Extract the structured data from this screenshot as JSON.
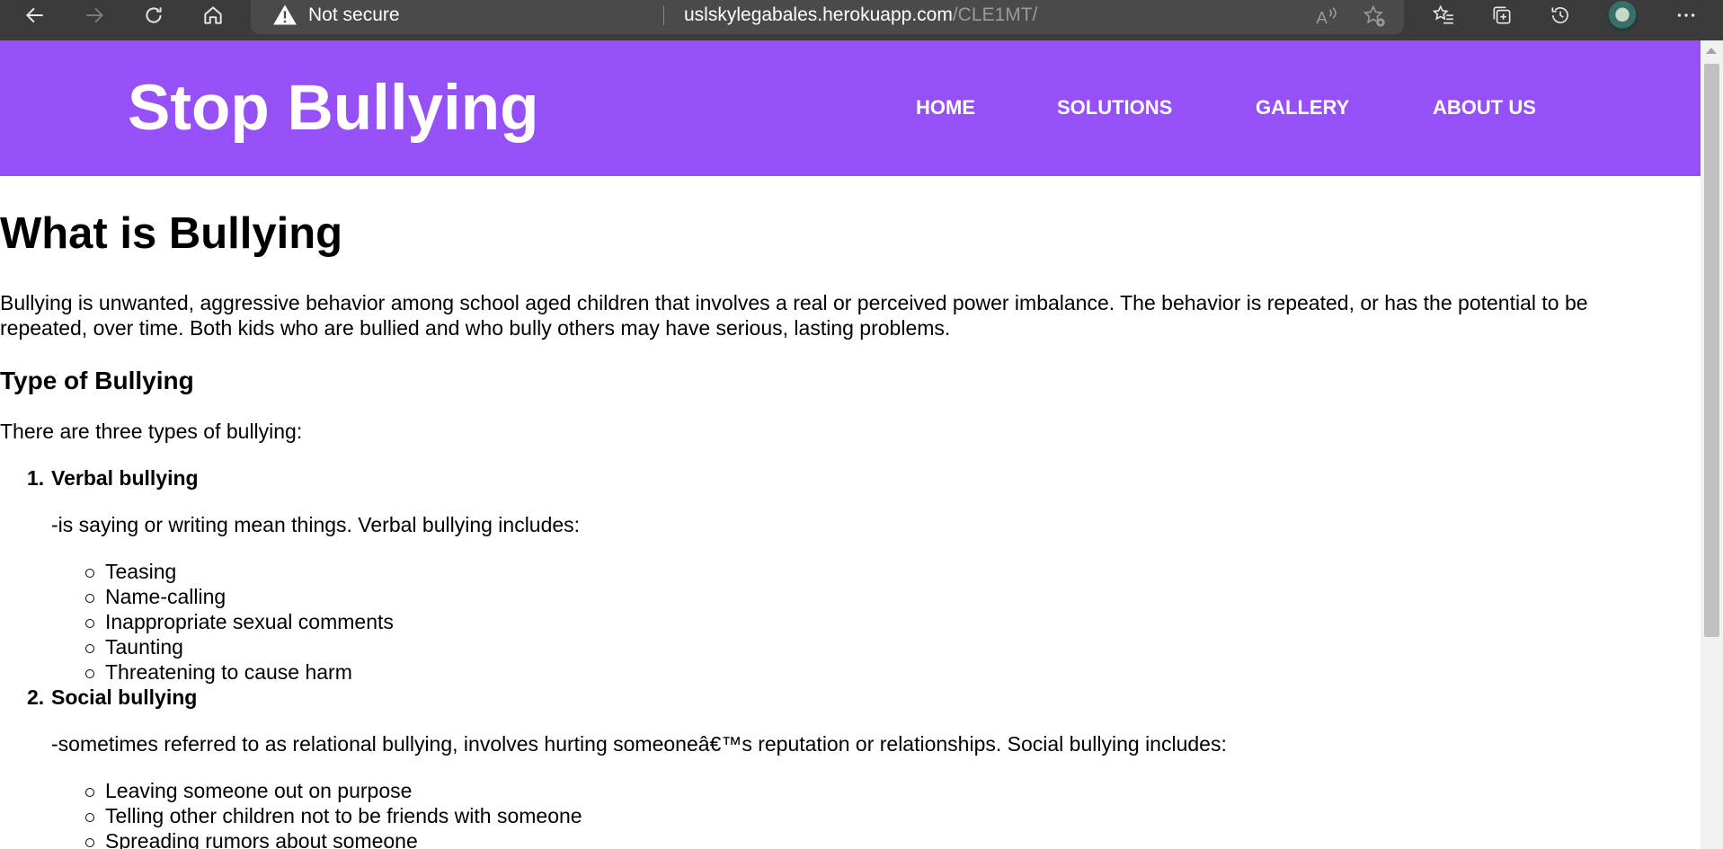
{
  "browser": {
    "security_label": "Not secure",
    "url_host": "uslskylegabales.herokuapp.com",
    "url_path": "/CLE1MT/"
  },
  "site": {
    "brand": "Stop Bullying",
    "nav": [
      "HOME",
      "SOLUTIONS",
      "GALLERY",
      "ABOUT US"
    ]
  },
  "content": {
    "title": "What is Bullying",
    "intro_line1": "Bullying is unwanted, aggressive behavior among school aged children that involves a real or perceived power imbalance. The behavior is repeated, or has the potential to be",
    "intro_line2": "repeated, over time. Both kids who are bullied and who bully others may have serious, lasting problems.",
    "types_heading": "Type of Bullying",
    "types_intro": "There are three types of bullying:",
    "types": [
      {
        "number": "1.",
        "name": "Verbal bullying",
        "description": "-is saying or writing mean things. Verbal bullying includes:",
        "items": [
          "Teasing",
          "Name-calling",
          "Inappropriate sexual comments",
          "Taunting",
          "Threatening to cause harm"
        ]
      },
      {
        "number": "2.",
        "name": "Social bullying",
        "description": "-sometimes referred to as relational bullying, involves hurting someoneâ€™s reputation or relationships. Social bullying includes:",
        "items": [
          "Leaving someone out on purpose",
          "Telling other children not to be friends with someone",
          "Spreading rumors about someone"
        ]
      }
    ]
  }
}
